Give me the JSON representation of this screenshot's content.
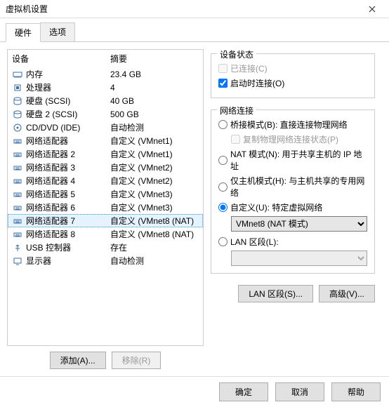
{
  "window": {
    "title": "虚拟机设置"
  },
  "tabs": {
    "hardware": "硬件",
    "options": "选项"
  },
  "list": {
    "header_device": "设备",
    "header_summary": "摘要",
    "items": [
      {
        "icon": "memory",
        "name": "内存",
        "summary": "23.4 GB",
        "sel": false
      },
      {
        "icon": "cpu",
        "name": "处理器",
        "summary": "4",
        "sel": false
      },
      {
        "icon": "disk",
        "name": "硬盘 (SCSI)",
        "summary": "40 GB",
        "sel": false
      },
      {
        "icon": "disk",
        "name": "硬盘 2 (SCSI)",
        "summary": "500 GB",
        "sel": false
      },
      {
        "icon": "cd",
        "name": "CD/DVD (IDE)",
        "summary": "自动检测",
        "sel": false
      },
      {
        "icon": "net",
        "name": "网络适配器",
        "summary": "自定义 (VMnet1)",
        "sel": false
      },
      {
        "icon": "net",
        "name": "网络适配器 2",
        "summary": "自定义 (VMnet1)",
        "sel": false
      },
      {
        "icon": "net",
        "name": "网络适配器 3",
        "summary": "自定义 (VMnet2)",
        "sel": false
      },
      {
        "icon": "net",
        "name": "网络适配器 4",
        "summary": "自定义 (VMnet2)",
        "sel": false
      },
      {
        "icon": "net",
        "name": "网络适配器 5",
        "summary": "自定义 (VMnet3)",
        "sel": false
      },
      {
        "icon": "net",
        "name": "网络适配器 6",
        "summary": "自定义 (VMnet3)",
        "sel": false
      },
      {
        "icon": "net",
        "name": "网络适配器 7",
        "summary": "自定义 (VMnet8 (NAT)",
        "sel": true
      },
      {
        "icon": "net",
        "name": "网络适配器 8",
        "summary": "自定义 (VMnet8 (NAT)",
        "sel": false
      },
      {
        "icon": "usb",
        "name": "USB 控制器",
        "summary": "存在",
        "sel": false
      },
      {
        "icon": "display",
        "name": "显示器",
        "summary": "自动检测",
        "sel": false
      }
    ]
  },
  "left_buttons": {
    "add": "添加(A)...",
    "remove": "移除(R)"
  },
  "device_status": {
    "title": "设备状态",
    "connected": "已连接(C)",
    "connect_at_power": "启动时连接(O)"
  },
  "network": {
    "title": "网络连接",
    "bridged": "桥接模式(B): 直接连接物理网络",
    "replicate": "复制物理网络连接状态(P)",
    "nat": "NAT 模式(N): 用于共享主机的 IP 地址",
    "hostonly": "仅主机模式(H): 与主机共享的专用网络",
    "custom": "自定义(U): 特定虚拟网络",
    "custom_value": "VMnet8 (NAT 模式)",
    "lan": "LAN 区段(L):",
    "lan_value": ""
  },
  "right_buttons": {
    "lan_seg": "LAN 区段(S)...",
    "advanced": "高级(V)..."
  },
  "footer": {
    "ok": "确定",
    "cancel": "取消",
    "help": "帮助"
  }
}
